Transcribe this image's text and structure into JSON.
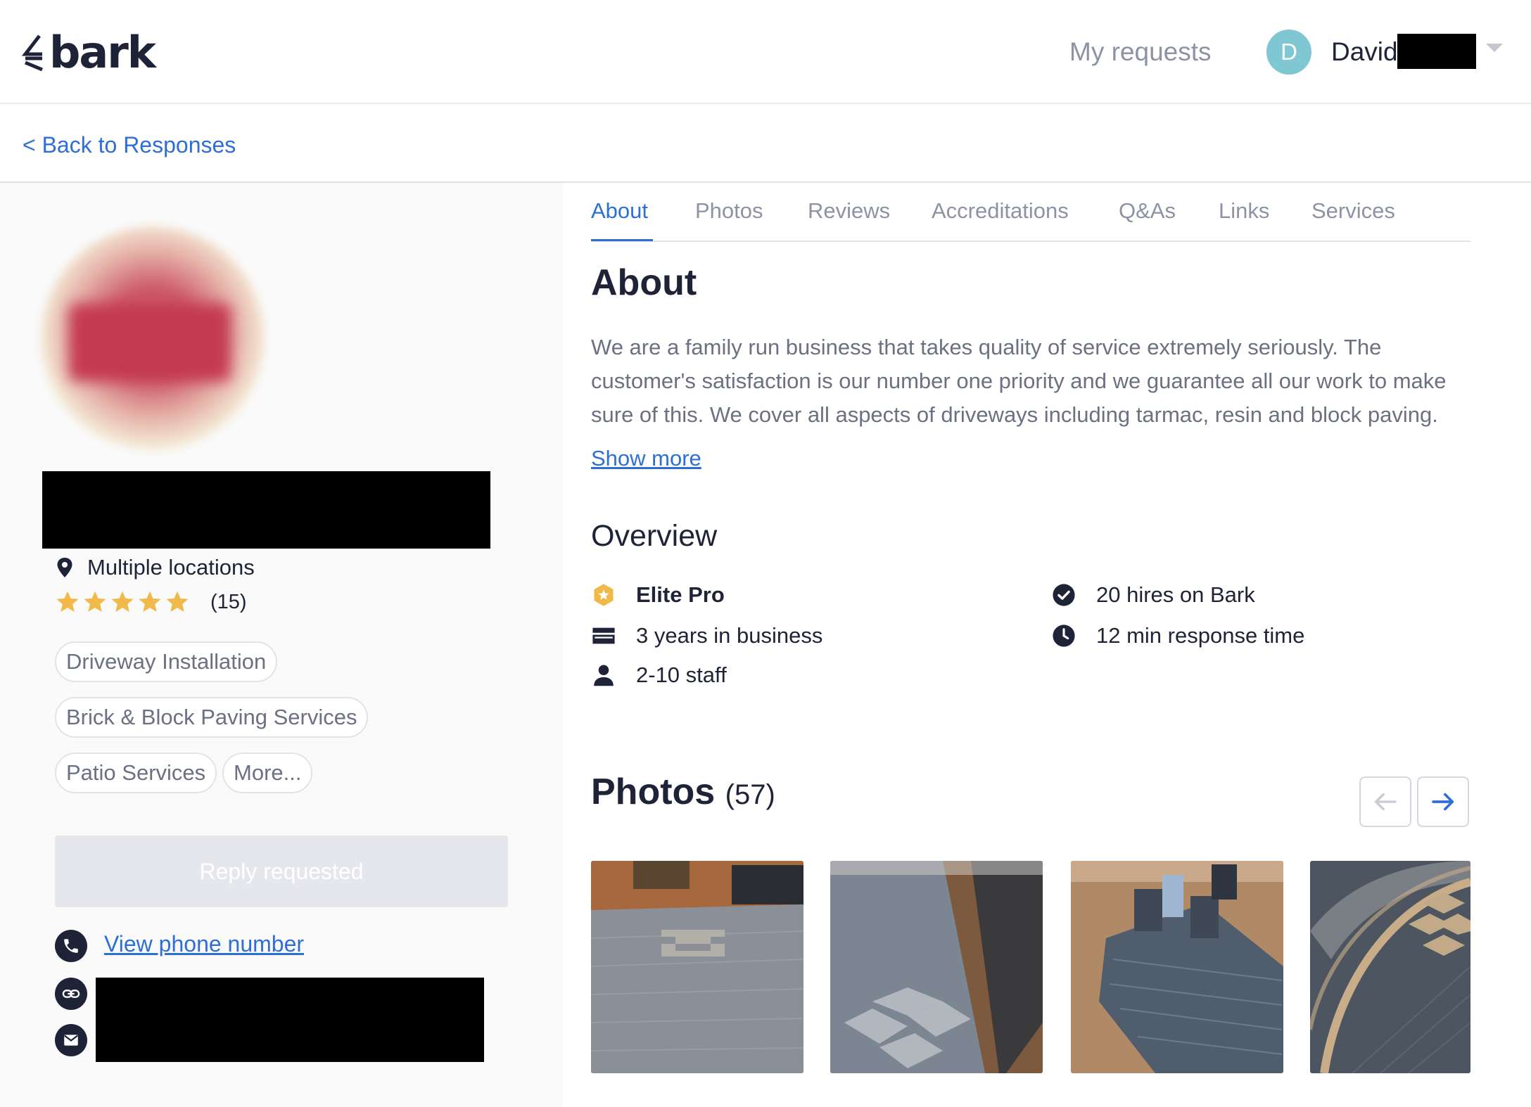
{
  "header": {
    "logo_text": "bark",
    "my_requests": "My requests",
    "avatar_initial": "D",
    "user_name": "David"
  },
  "backbar": {
    "back_label": "< Back to Responses"
  },
  "profile": {
    "location": "Multiple locations",
    "rating_stars": 5,
    "rating_count": "(15)",
    "tags": [
      "Driveway Installation",
      "Brick & Block Paving Services",
      "Patio Services",
      "More..."
    ],
    "reply_button": "Reply requested",
    "view_phone": "View phone number"
  },
  "tabs": [
    "About",
    "Photos",
    "Reviews",
    "Accreditations",
    "Q&As",
    "Links",
    "Services"
  ],
  "active_tab": "About",
  "about": {
    "title": "About",
    "text": "We are a family run business that takes quality of service extremely seriously. The customer's satisfaction is our number one priority and we guarantee all our work to make sure of this. We cover all aspects of driveways including tarmac, resin and block paving.",
    "show_more": "Show more"
  },
  "overview": {
    "title": "Overview",
    "items": [
      {
        "icon": "elite-badge-icon",
        "text": "Elite Pro"
      },
      {
        "icon": "hires-check-icon",
        "text": "20 hires on Bark"
      },
      {
        "icon": "business-icon",
        "text": "3 years in business"
      },
      {
        "icon": "clock-icon",
        "text": "12 min response time"
      },
      {
        "icon": "person-icon",
        "text": "2-10 staff"
      }
    ]
  },
  "photos": {
    "title": "Photos",
    "count": "(57)"
  },
  "colors": {
    "accent": "#2d6fd6",
    "dark": "#1e2338",
    "muted": "#8d93a4",
    "star": "#f0b94a",
    "avatar": "#7fc7d3"
  }
}
